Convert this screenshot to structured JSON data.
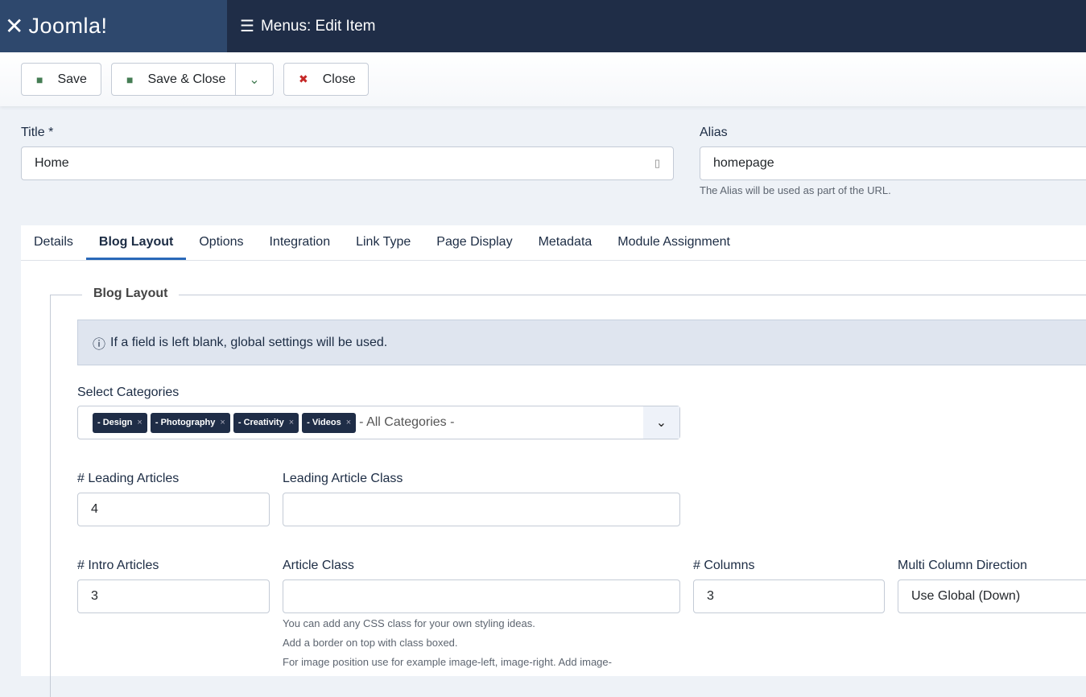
{
  "header": {
    "logo": "Joomla!",
    "title": "Menus: Edit Item"
  },
  "toolbar": {
    "save": "Save",
    "save_close": "Save & Close",
    "close": "Close"
  },
  "title_field": {
    "label": "Title *",
    "value": "Home"
  },
  "alias_field": {
    "label": "Alias",
    "value": "homepage",
    "help": "The Alias will be used as part of the URL."
  },
  "tabs": [
    "Details",
    "Blog Layout",
    "Options",
    "Integration",
    "Link Type",
    "Page Display",
    "Metadata",
    "Module Assignment"
  ],
  "fieldset": {
    "legend": "Blog Layout",
    "alert": "If a field is left blank, global settings will be used."
  },
  "categories": {
    "label": "Select Categories",
    "chips": [
      "- Design",
      "- Photography",
      "- Creativity",
      "- Videos"
    ],
    "placeholder": "- All Categories -"
  },
  "leading_articles": {
    "label": "# Leading Articles",
    "value": "4"
  },
  "leading_class": {
    "label": "Leading Article Class",
    "value": ""
  },
  "intro_articles": {
    "label": "# Intro Articles",
    "value": "3"
  },
  "article_class": {
    "label": "Article Class",
    "value": "",
    "help": [
      "You can add any CSS class for your own styling ideas.",
      "Add a border on top with class boxed.",
      "For image position use for example image-left, image-right. Add image-"
    ]
  },
  "columns": {
    "label": "# Columns",
    "value": "3"
  },
  "multi_column": {
    "label": "Multi Column Direction",
    "value": "Use Global (Down)"
  }
}
